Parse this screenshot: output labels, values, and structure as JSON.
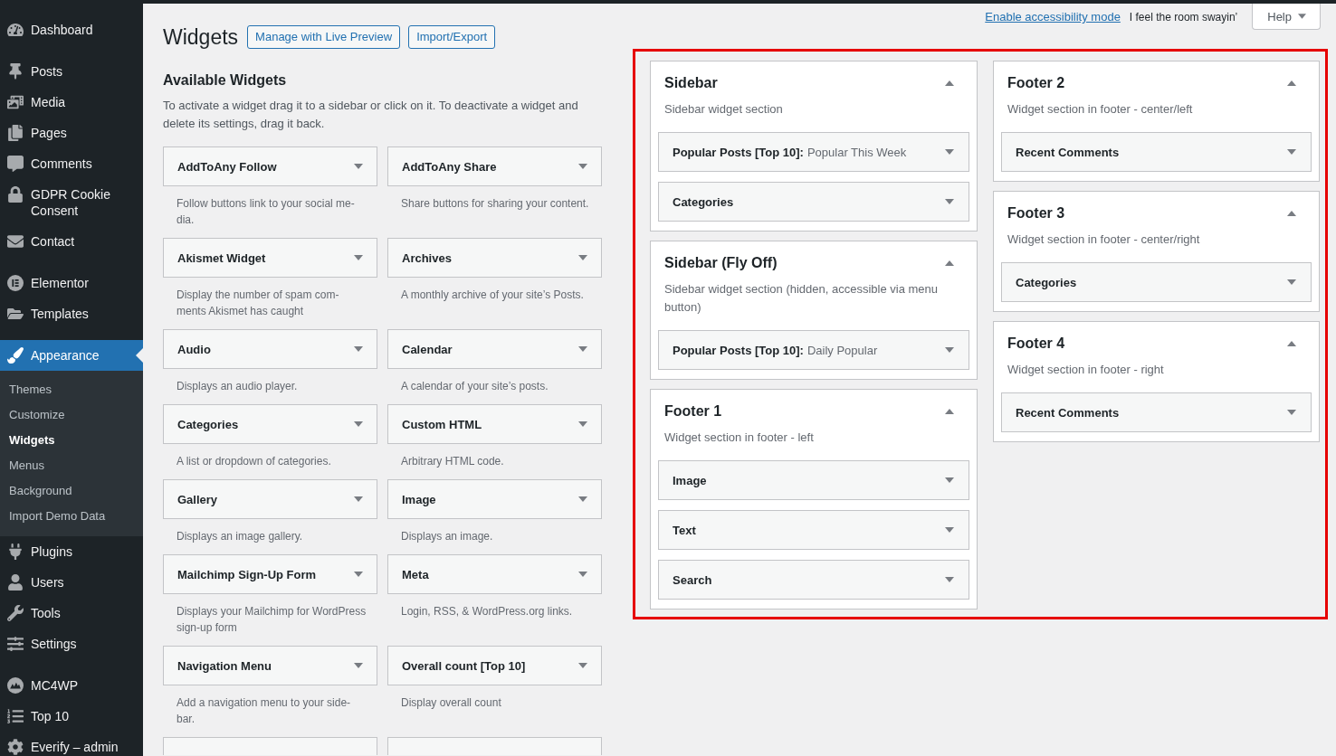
{
  "admin_menu": {
    "groups": [
      {
        "items": [
          {
            "label": "Dashboard",
            "selected": false
          }
        ]
      },
      {
        "items": [
          {
            "label": "Posts",
            "selected": false
          },
          {
            "label": "Media",
            "selected": false
          },
          {
            "label": "Pages",
            "selected": false
          },
          {
            "label": "Comments",
            "selected": false
          },
          {
            "label": "GDPR Cookie Consent",
            "selected": false
          },
          {
            "label": "Contact",
            "selected": false
          }
        ]
      },
      {
        "items": [
          {
            "label": "Elementor",
            "selected": false
          },
          {
            "label": "Templates",
            "selected": false
          }
        ]
      },
      {
        "items": [
          {
            "label": "Appearance",
            "selected": true,
            "children": [
              {
                "label": "Themes",
                "selected": false
              },
              {
                "label": "Customize",
                "selected": false
              },
              {
                "label": "Widgets",
                "selected": true
              },
              {
                "label": "Menus",
                "selected": false
              },
              {
                "label": "Background",
                "selected": false
              },
              {
                "label": "Import Demo Data",
                "selected": false
              }
            ]
          },
          {
            "label": "Plugins",
            "selected": false
          },
          {
            "label": "Users",
            "selected": false
          },
          {
            "label": "Tools",
            "selected": false
          },
          {
            "label": "Settings",
            "selected": false
          }
        ]
      },
      {
        "items": [
          {
            "label": "MC4WP",
            "selected": false
          },
          {
            "label": "Top 10",
            "selected": false
          },
          {
            "label": "Everify – admin",
            "selected": false
          }
        ]
      }
    ]
  },
  "page_header": {
    "title": "Widgets",
    "buttons": [
      {
        "label": "Manage with Live Preview"
      },
      {
        "label": "Import/Export"
      }
    ]
  },
  "screen_meta": {
    "accessibility_link": "Enable accessibility mode",
    "hello_dolly": "I feel the room swayin’",
    "help_button": "Help"
  },
  "available_widgets": {
    "title": "Available Widgets",
    "description": "To activate a widget drag it to a sidebar or click on it. To deactivate a widget and delete its settings, drag it back.",
    "widgets": [
      {
        "kind": "widget",
        "title": "AddToAny Follow",
        "description": "Follow buttons link to your social me-dia."
      },
      {
        "kind": "widget",
        "title": "AddToAny Share",
        "description": "Share buttons for sharing your content."
      },
      {
        "kind": "widget",
        "title": "Akismet Widget",
        "description": "Display the number of spam com-ments Akismet has caught"
      },
      {
        "kind": "widget",
        "title": "Archives",
        "description": "A monthly archive of your site’s Posts."
      },
      {
        "kind": "widget",
        "title": "Audio",
        "description": "Displays an audio player."
      },
      {
        "kind": "widget",
        "title": "Calendar",
        "description": "A calendar of your site’s posts."
      },
      {
        "kind": "widget",
        "title": "Categories",
        "description": "A list or dropdown of categories."
      },
      {
        "kind": "widget",
        "title": "Custom HTML",
        "description": "Arbitrary HTML code."
      },
      {
        "kind": "widget",
        "title": "Gallery",
        "description": "Displays an image gallery."
      },
      {
        "kind": "widget",
        "title": "Image",
        "description": "Displays an image."
      },
      {
        "kind": "widget",
        "title": "Mailchimp Sign-Up Form",
        "description": "Displays your Mailchimp for WordPress sign-up form"
      },
      {
        "kind": "widget",
        "title": "Meta",
        "description": "Login, RSS, & WordPress.org links."
      },
      {
        "kind": "widget",
        "title": "Navigation Menu",
        "description": "Add a navigation menu to your side-bar."
      },
      {
        "kind": "widget",
        "title": "Overall count [Top 10]",
        "description": "Display overall count"
      },
      {
        "kind": "cut_off"
      },
      {
        "kind": "cut_off"
      }
    ]
  },
  "widget_areas": {
    "highlighted": true,
    "columns": [
      {
        "areas": [
          {
            "title": "Sidebar",
            "description": "Sidebar widget section",
            "expanded": true,
            "widgets": [
              {
                "title": "Popular Posts [Top 10]:",
                "instance_title": "Popular This Week",
                "expanded": false
              },
              {
                "title": "Categories",
                "expanded": false
              }
            ]
          },
          {
            "title": "Sidebar (Fly Off)",
            "description": "Sidebar widget section (hidden, accessible via menu button)",
            "expanded": true,
            "widgets": [
              {
                "title": "Popular Posts [Top 10]:",
                "instance_title": "Daily Popular",
                "expanded": false
              }
            ]
          },
          {
            "title": "Footer 1",
            "description": "Widget section in footer - left",
            "expanded": true,
            "widgets": [
              {
                "title": "Image",
                "expanded": false
              },
              {
                "title": "Text",
                "expanded": false
              },
              {
                "title": "Search",
                "expanded": false
              }
            ]
          }
        ]
      },
      {
        "areas": [
          {
            "title": "Footer 2",
            "description": "Widget section in footer - center/left",
            "expanded": true,
            "widgets": [
              {
                "title": "Recent Comments",
                "expanded": false
              }
            ]
          },
          {
            "title": "Footer 3",
            "description": "Widget section in footer - center/right",
            "expanded": true,
            "widgets": [
              {
                "title": "Categories",
                "expanded": false
              }
            ]
          },
          {
            "title": "Footer 4",
            "description": "Widget section in footer - right",
            "expanded": true,
            "widgets": [
              {
                "title": "Recent Comments",
                "expanded": false
              }
            ]
          }
        ]
      }
    ]
  }
}
